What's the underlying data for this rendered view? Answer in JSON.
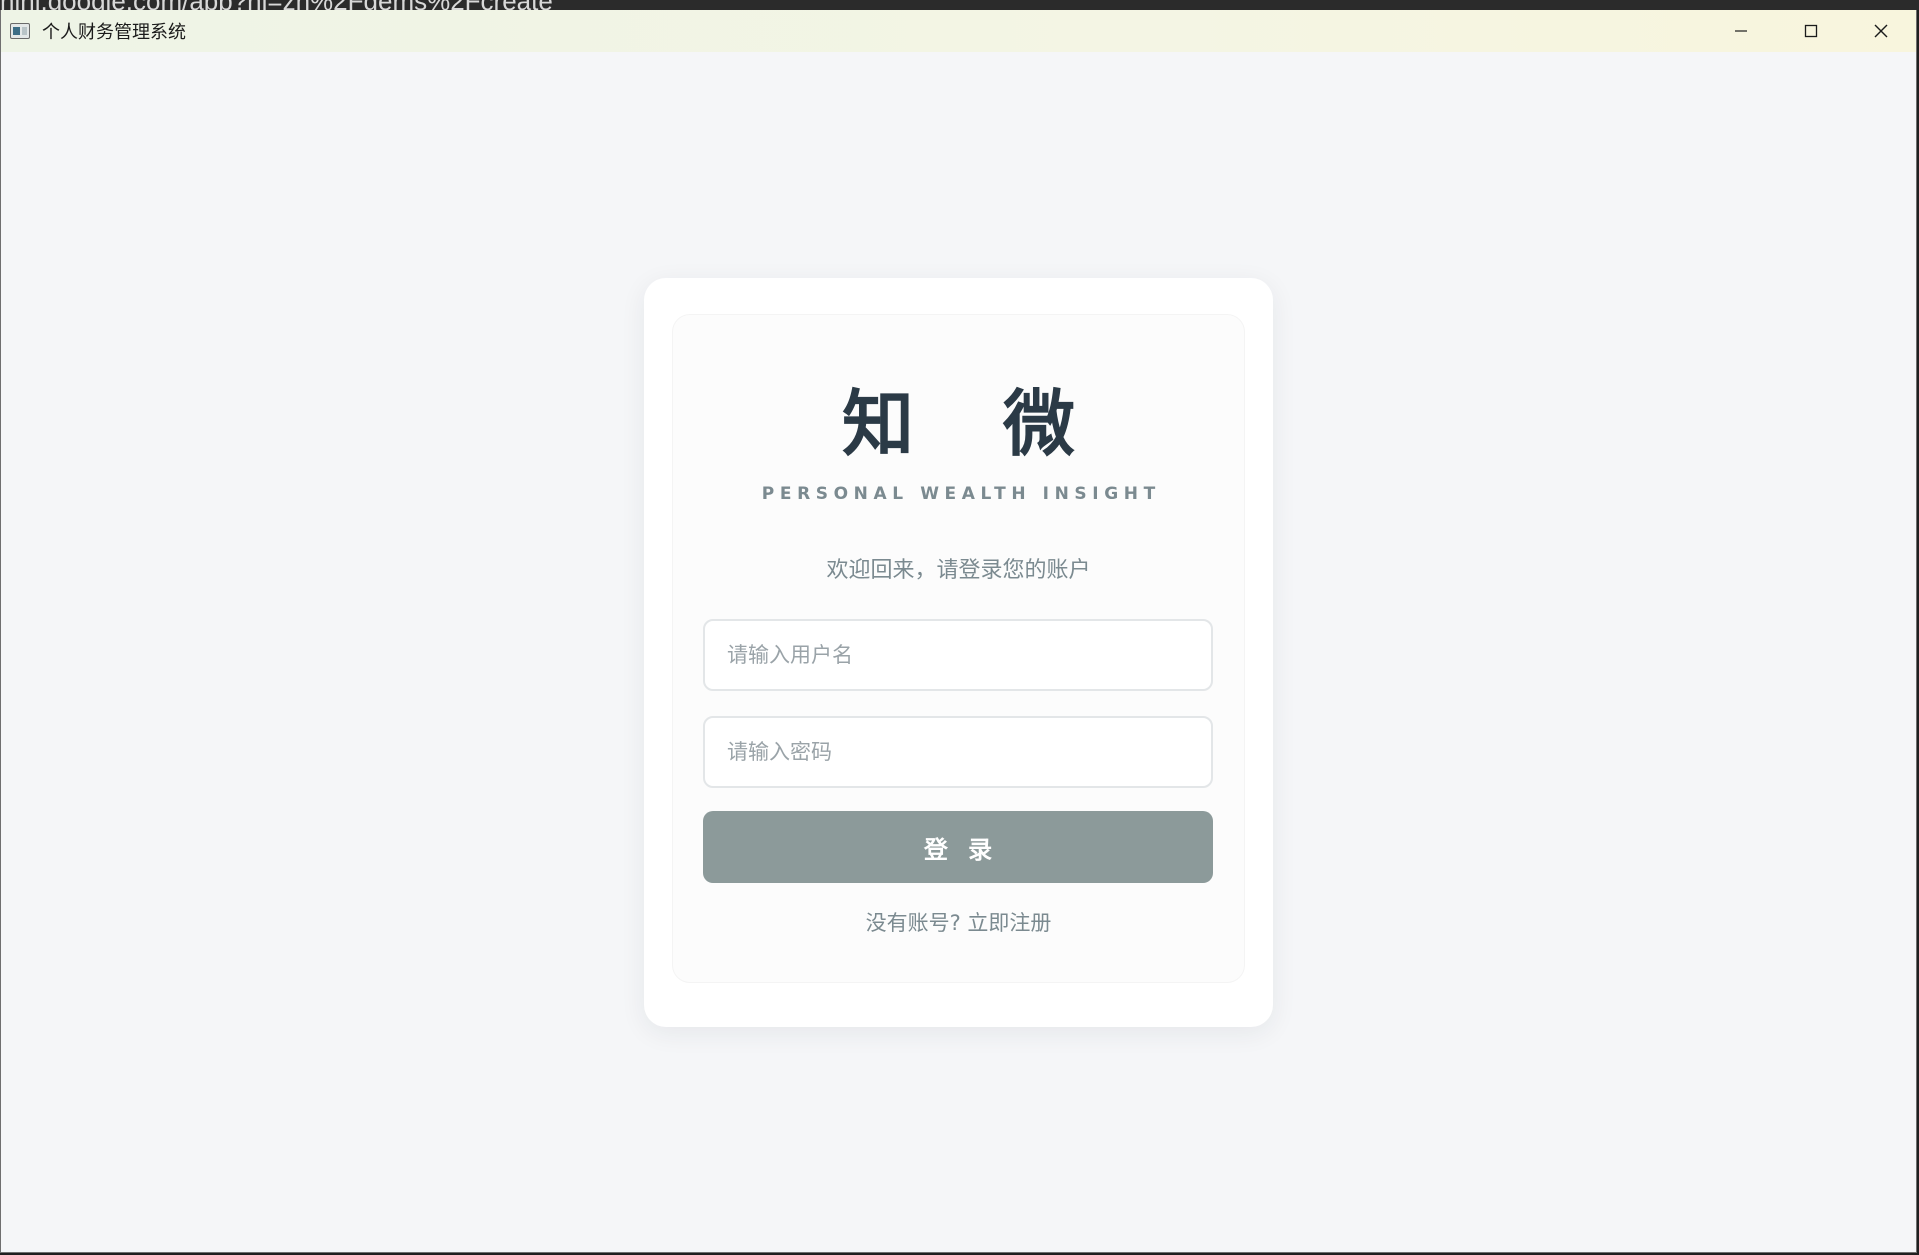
{
  "browser": {
    "url_fragment": "nini.google.com/app?hl=zh%2Fgems%2Fcreate"
  },
  "window": {
    "title": "个人财务管理系统",
    "controls": {
      "minimize_icon": "minimize-icon",
      "maximize_icon": "maximize-icon",
      "close_icon": "close-icon"
    }
  },
  "login": {
    "brand_title": "知 微",
    "brand_subtitle": "PERSONAL WEALTH INSIGHT",
    "welcome_text": "欢迎回来，请登录您的账户",
    "username_placeholder": "请输入用户名",
    "password_placeholder": "请输入密码",
    "login_button_label": "登 录",
    "register_link_text": "没有账号? 立即注册"
  },
  "colors": {
    "page_background": "#f5f6f8",
    "card_background": "#ffffff",
    "brand_title": "#2b3a46",
    "muted_text": "#7b8a90",
    "button_background": "#8c9a9a",
    "button_text": "#ffffff",
    "input_border": "#e3e6e8"
  }
}
